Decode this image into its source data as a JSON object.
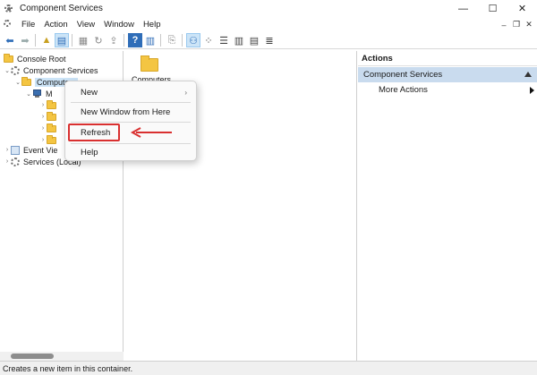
{
  "window": {
    "title": "Component Services",
    "controls": {
      "minimize": "—",
      "maximize": "☐",
      "close": "✕"
    }
  },
  "menubar": {
    "items": [
      "File",
      "Action",
      "View",
      "Window",
      "Help"
    ],
    "mdi": {
      "minimize": "–",
      "restore": "❐",
      "close": "✕"
    }
  },
  "tree": {
    "root": "Console Root",
    "component_services": "Component Services",
    "computers": "Computers",
    "my_computer": "M",
    "event_viewer": "Event Vie",
    "services": "Services (Local)"
  },
  "center": {
    "folder_label": "Computers"
  },
  "actions": {
    "header": "Actions",
    "section": "Component Services",
    "more_actions": "More Actions"
  },
  "context_menu": {
    "items": [
      "New",
      "New Window from Here",
      "Refresh",
      "Help"
    ],
    "submenu_arrow": "›"
  },
  "statusbar": {
    "text": "Creates a new item in this container."
  },
  "colors": {
    "annotation_red": "#d93030",
    "selection_blue": "#cce4f7",
    "actions_section": "#c9dbee"
  },
  "icons": [
    "app-gear-icon",
    "back-icon",
    "forward-icon",
    "up-folder-icon",
    "show-hide-tree-icon",
    "help-icon",
    "folder-icon",
    "computer-icon"
  ]
}
